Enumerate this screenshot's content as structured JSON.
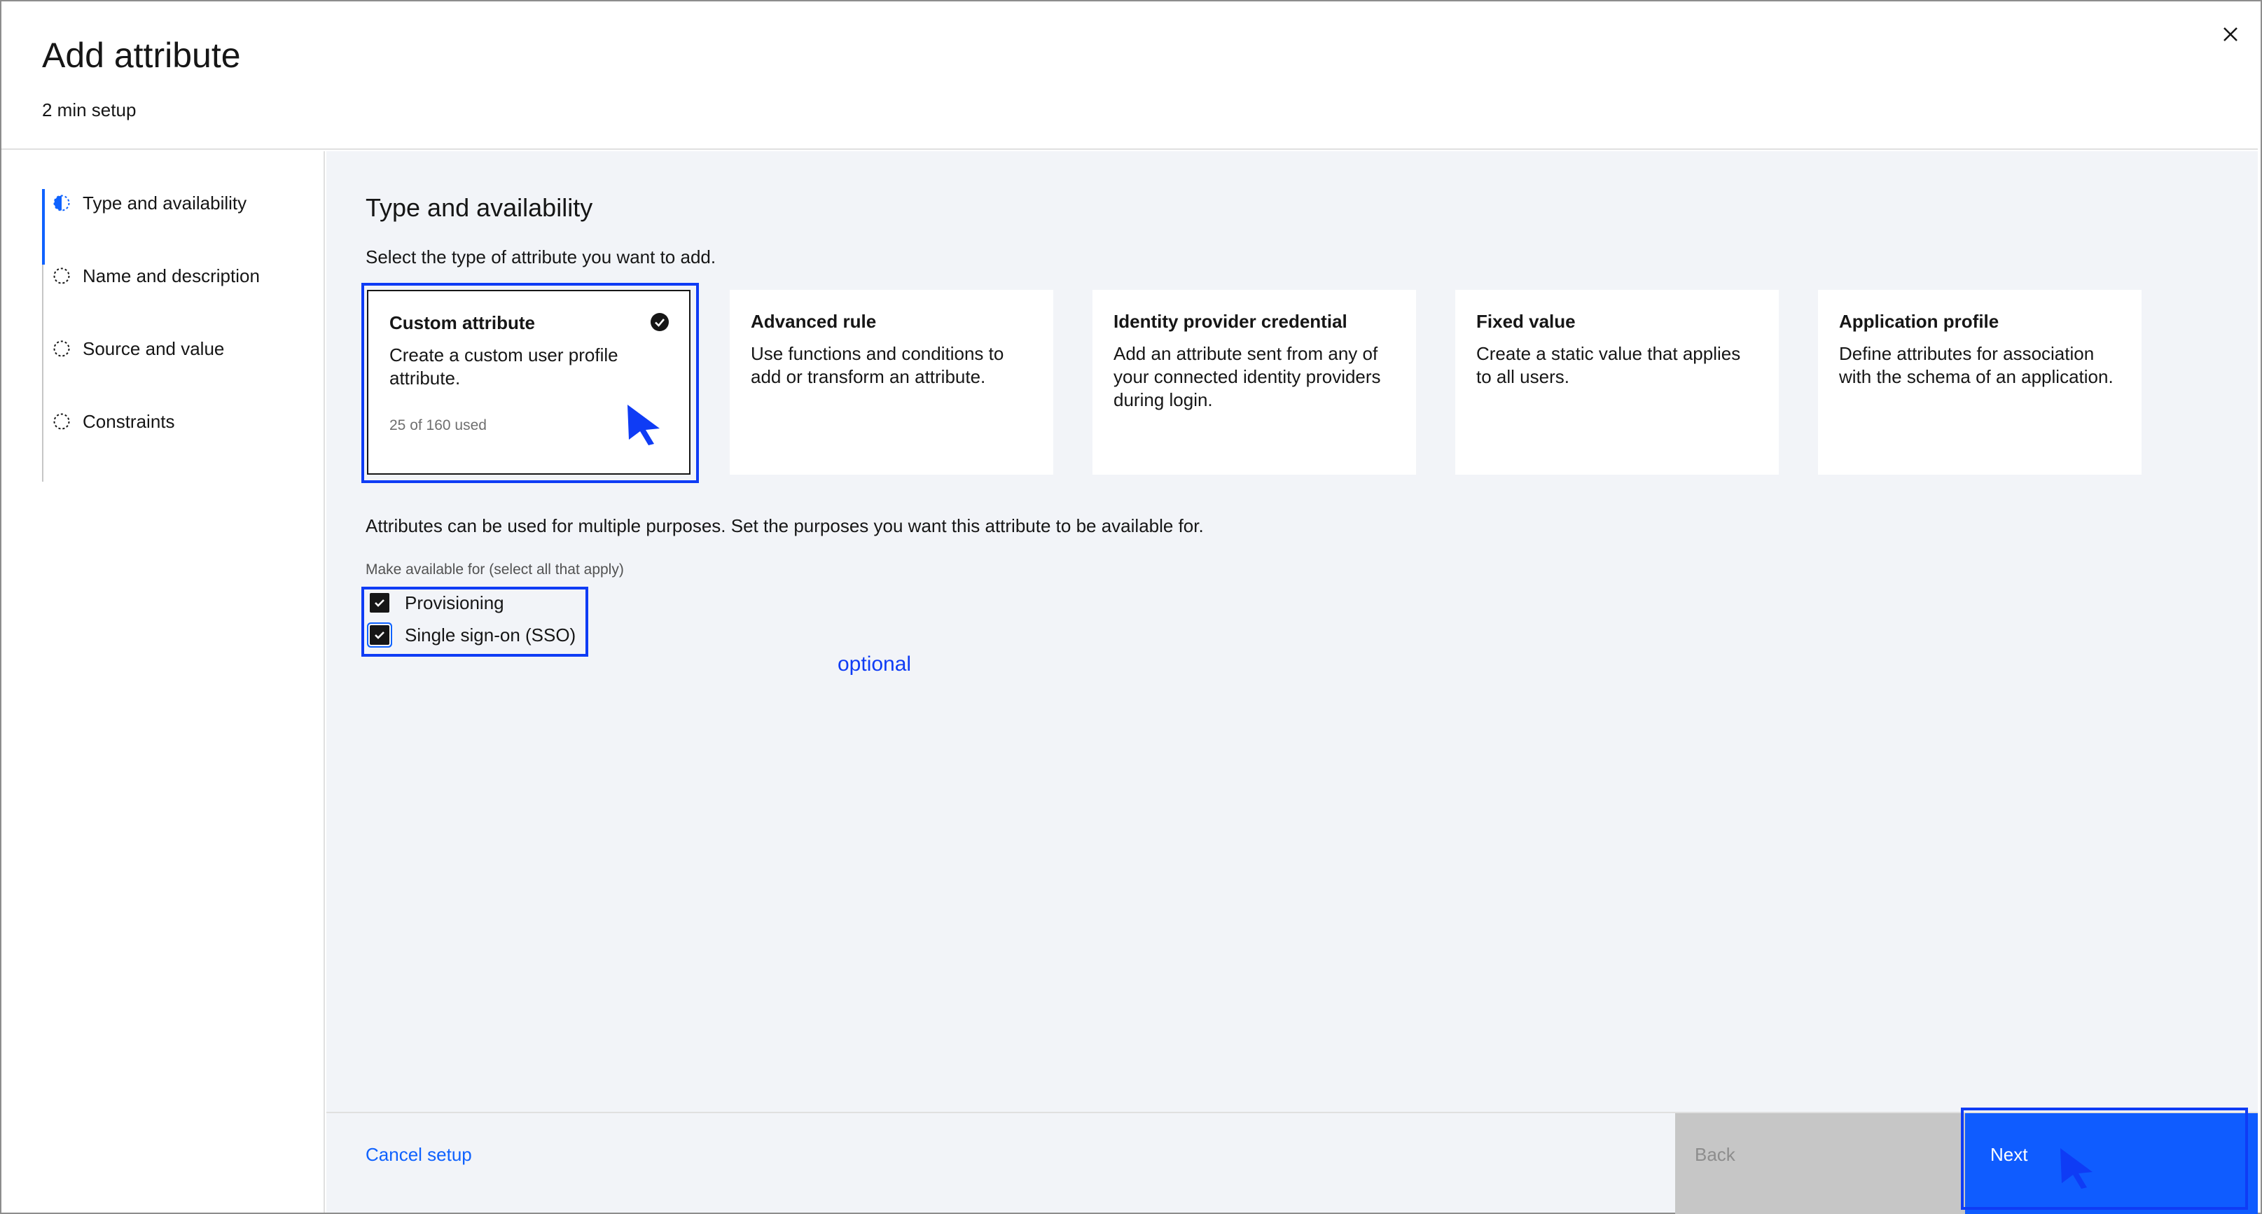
{
  "header": {
    "title": "Add attribute",
    "subtitle": "2 min setup"
  },
  "progress": {
    "steps": [
      {
        "label": "Type and availability",
        "state": "current"
      },
      {
        "label": "Name and description",
        "state": "incomplete"
      },
      {
        "label": "Source and value",
        "state": "incomplete"
      },
      {
        "label": "Constraints",
        "state": "incomplete"
      }
    ]
  },
  "main": {
    "section_title": "Type and availability",
    "section_description": "Select the type of attribute you want to add.",
    "tiles": [
      {
        "title": "Custom attribute",
        "description": "Create a custom user profile attribute.",
        "usage": "25 of 160 used",
        "selected": true
      },
      {
        "title": "Advanced rule",
        "description": "Use functions and conditions to add or transform an attribute.",
        "selected": false
      },
      {
        "title": "Identity provider credential",
        "description": "Add an attribute sent from any of your connected identity providers during login.",
        "selected": false
      },
      {
        "title": "Fixed value",
        "description": "Create a static value that applies to all users.",
        "selected": false
      },
      {
        "title": "Application profile",
        "description": "Define attributes for association with the schema of an application.",
        "selected": false
      }
    ],
    "purposes_description": "Attributes can be used for multiple purposes. Set the purposes you want this attribute to be available for.",
    "purposes_group_label": "Make available for (select all that apply)",
    "checkboxes": [
      {
        "label": "Provisioning",
        "checked": true
      },
      {
        "label": "Single sign-on (SSO)",
        "checked": true
      }
    ],
    "annotation_optional": "optional"
  },
  "footer": {
    "cancel_label": "Cancel setup",
    "back_label": "Back",
    "next_label": "Next"
  },
  "icons": {
    "close": "close-icon",
    "step_current": "half-circle-icon",
    "step_incomplete": "dashed-circle-icon",
    "tile_selected": "checkmark-filled-icon",
    "cursor": "cursor-arrow-icon"
  },
  "colors": {
    "primary": "#0f62fe",
    "annotation": "#0f3cf5",
    "background": "#f2f4f8",
    "disabled": "#c6c6c6"
  }
}
